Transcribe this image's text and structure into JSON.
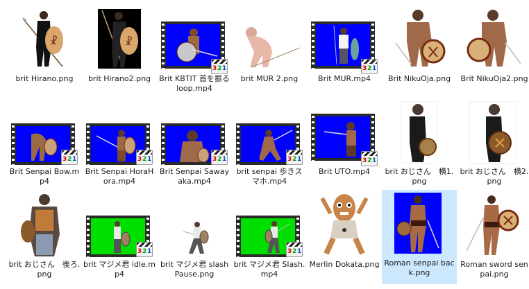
{
  "files": [
    {
      "label": "brit Hirano.png",
      "icon": "image-thumbnail",
      "selected": false
    },
    {
      "label": "brit Hirano2.png",
      "icon": "image-thumbnail",
      "selected": false
    },
    {
      "label": "Brit KBTIT 首を振る loop.mp4",
      "icon": "video-thumbnail",
      "selected": false
    },
    {
      "label": "brit MUR 2.png",
      "icon": "image-thumbnail",
      "selected": false
    },
    {
      "label": "Brit MUR.mp4",
      "icon": "video-thumbnail",
      "selected": false
    },
    {
      "label": "Brit NikuOja.png",
      "icon": "image-thumbnail",
      "selected": false
    },
    {
      "label": "Brit NikuOja2.png",
      "icon": "image-thumbnail",
      "selected": false
    },
    {
      "label": "Brit Senpai Bow.mp4",
      "icon": "video-thumbnail",
      "selected": false
    },
    {
      "label": "Brit Senpai HoraHora.mp4",
      "icon": "video-thumbnail",
      "selected": false
    },
    {
      "label": "Brit Senpai Sawayaka.mp4",
      "icon": "video-thumbnail",
      "selected": false
    },
    {
      "label": "brit senpai 歩きスマホ.mp4",
      "icon": "video-thumbnail",
      "selected": false
    },
    {
      "label": "Brit UTO.mp4",
      "icon": "video-thumbnail",
      "selected": false
    },
    {
      "label": "brit おじさん　横1.png",
      "icon": "image-thumbnail",
      "selected": false
    },
    {
      "label": "brit おじさん　横2.png",
      "icon": "image-thumbnail",
      "selected": false
    },
    {
      "label": "brit おじさん　後ろ.png",
      "icon": "image-thumbnail",
      "selected": false
    },
    {
      "label": "brit マジメ君 idle.mp4",
      "icon": "video-thumbnail",
      "selected": false
    },
    {
      "label": "brit マジメ君 slash Pause.png",
      "icon": "image-thumbnail",
      "selected": false
    },
    {
      "label": "brit マジメ君 Slash.mp4",
      "icon": "video-thumbnail",
      "selected": false
    },
    {
      "label": "Merlin Dokata.png",
      "icon": "image-thumbnail",
      "selected": false
    },
    {
      "label": "Roman senpai back.png",
      "icon": "image-thumbnail",
      "selected": true
    },
    {
      "label": "Roman sword senpai.png",
      "icon": "image-thumbnail",
      "selected": false
    }
  ],
  "badge_text": "321",
  "colors": {
    "selection": "#cce8ff",
    "blue_screen": "#0000ff",
    "green_screen": "#00e000",
    "film": "#2a2a2a",
    "text": "#1a1a1a"
  }
}
